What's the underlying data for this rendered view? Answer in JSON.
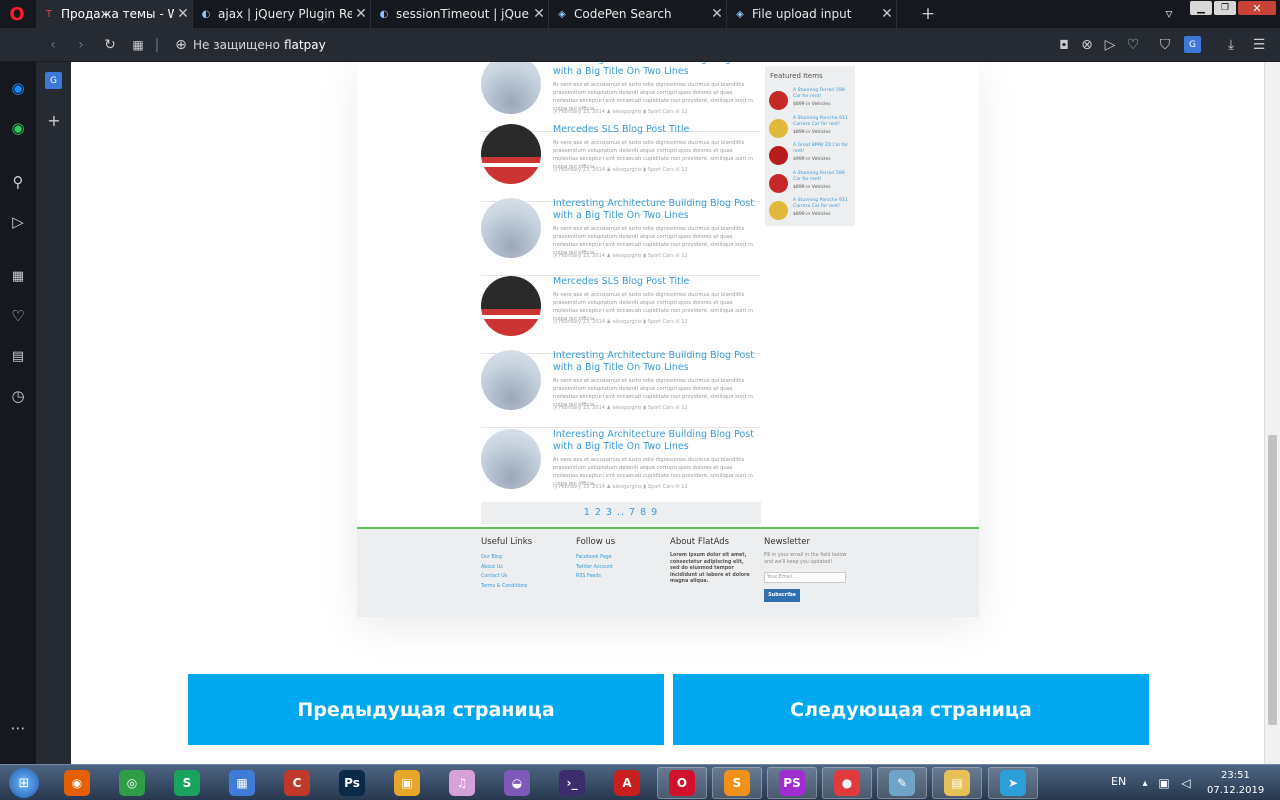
{
  "browser": {
    "tabs": [
      {
        "title": "Продажа темы - WordPress",
        "fav": "T"
      },
      {
        "title": "ajax | jQuery Plugin Registry",
        "fav": "◐"
      },
      {
        "title": "sessionTimeout | jQuery Plugin",
        "fav": "◐"
      },
      {
        "title": "CodePen Search",
        "fav": "◈"
      },
      {
        "title": "File upload input",
        "fav": "◈"
      }
    ],
    "address": {
      "security": "Не защищено",
      "url": "flatpay"
    }
  },
  "preview": {
    "posts": [
      {
        "title": "Interesting Architecture Building Blog Post with a Big Title On Two Lines",
        "img": "tower"
      },
      {
        "title": "Mercedes SLS Blog Post Title",
        "img": "car"
      },
      {
        "title": "Interesting Architecture Building Blog Post with a Big Title On Two Lines",
        "img": "tower"
      },
      {
        "title": "Mercedes SLS Blog Post Title",
        "img": "car"
      },
      {
        "title": "Interesting Architecture Building Blog Post with a Big Title On Two Lines",
        "img": "tower"
      },
      {
        "title": "Interesting Architecture Building Blog Post with a Big Title On Two Lines",
        "img": "tower"
      }
    ],
    "post_excerpt": "At vero eos et accusamus et iusto odio dignissimos ducimus qui blanditiis praesentium voluptatum deleniti atque corrupti quos dolores et quas molestias excepturi sint occaecati cupiditate non provident, similique sunt in culpa qui officia",
    "post_meta": "◷ February 13, 2014   ♟ alexgurghis   ▮ Sport Cars   ✉ 12",
    "featured_title": "Featured Items",
    "featured_items": [
      {
        "name": "A Stunning Ferrari 599 Car for rent!",
        "price": "$899 in Vehicles",
        "color": "#c62828"
      },
      {
        "name": "A Stunning Porsche 911 Carrera Car for rent!",
        "price": "$899 in Vehicles",
        "color": "#e0b93a"
      },
      {
        "name": "A Great BMW Z4 Car for rent!",
        "price": "$999 in Vehicles",
        "color": "#b71c1c"
      },
      {
        "name": "A Stunning Ferrari 599 Car for rent!",
        "price": "$899 in Vehicles",
        "color": "#c62828"
      },
      {
        "name": "A Stunning Porsche 911 Carrera Car for rent!",
        "price": "$899 in Vehicles",
        "color": "#e0b93a"
      }
    ],
    "pager": "1 2 3 .. 7 8 9",
    "footer": {
      "useful_title": "Useful Links",
      "useful_links": [
        "Our Blog",
        "About Us",
        "Contact Us",
        "Terms & Conditions"
      ],
      "follow_title": "Follow us",
      "follow_links": [
        "Facebook Page",
        "Twitter Account",
        "RSS Feeds"
      ],
      "about_title": "About FlatAds",
      "about_text": "Lorem ipsum dolor sit amet, consectetur adipiscing elit, sed do eiusmod tempor incididunt ut labore et dolore magna aliqua.",
      "newsletter_title": "Newsletter",
      "newsletter_text": "Fill in your email in the field below and we'll keep you updated!",
      "email_placeholder": "Your Email...",
      "subscribe": "Subscribe"
    }
  },
  "nav": {
    "prev": "Предыдущая страница",
    "next": "Следующая страница"
  },
  "taskbar": {
    "lang": "EN",
    "time": "23:51",
    "date": "07.12.2019",
    "apps": [
      {
        "icon": "firefox-icon",
        "glyph": "◉",
        "color": "#e66000"
      },
      {
        "icon": "chrome-icon",
        "glyph": "◎",
        "color": "#2e9d46"
      },
      {
        "icon": "s-app-icon",
        "glyph": "S",
        "color": "#1aa35f"
      },
      {
        "icon": "paint-icon",
        "glyph": "▦",
        "color": "#3f7bd8"
      },
      {
        "icon": "ccleaner-icon",
        "glyph": "C",
        "color": "#c0392b"
      },
      {
        "icon": "photoshop-icon",
        "glyph": "Ps",
        "color": "#0b2a4a"
      },
      {
        "icon": "mobile-icon",
        "glyph": "▣",
        "color": "#e4a72a"
      },
      {
        "icon": "itunes-icon",
        "glyph": "♫",
        "color": "#d6a0d8"
      },
      {
        "icon": "cat-icon",
        "glyph": "◒",
        "color": "#7e5ab8"
      },
      {
        "icon": "terminal-icon",
        "glyph": "›_",
        "color": "#3b2d6b"
      },
      {
        "icon": "acrobat-icon",
        "glyph": "A",
        "color": "#c7201f"
      },
      {
        "icon": "opera-icon",
        "glyph": "O",
        "color": "#d0122c"
      },
      {
        "icon": "sublime-icon",
        "glyph": "S",
        "color": "#f29019"
      },
      {
        "icon": "phpstorm-icon",
        "glyph": "PS",
        "color": "#a02dd0"
      },
      {
        "icon": "color-wheel-icon",
        "glyph": "●",
        "color": "#e03a3a"
      },
      {
        "icon": "notes-icon",
        "glyph": "✎",
        "color": "#6fa3c8"
      },
      {
        "icon": "folder-icon",
        "glyph": "▤",
        "color": "#e8c05a"
      },
      {
        "icon": "telegram-icon",
        "glyph": "➤",
        "color": "#2c9fd8"
      }
    ]
  },
  "colors": {
    "accent": "#00a8ef",
    "link": "#3a9ad9"
  }
}
